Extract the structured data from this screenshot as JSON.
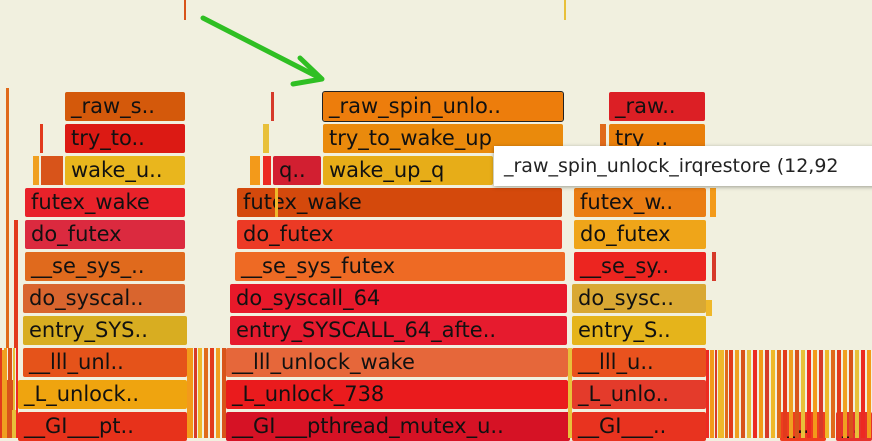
{
  "colors": {
    "background": "#f1f0df",
    "arrow": "#2fbf23",
    "selection_outline": "#222222"
  },
  "tooltip": {
    "text": "_raw_spin_unlock_irqrestore (12,92"
  },
  "frames": [
    {
      "id": "raw_s_left",
      "label": "_raw_s..",
      "color": "#d4590b"
    },
    {
      "id": "try_to_left",
      "label": "try_to..",
      "color": "#dc1a14"
    },
    {
      "id": "wake_u_left",
      "label": "wake_u..",
      "color": "#e9b61d"
    },
    {
      "id": "futex_wake_left",
      "label": "futex_wake",
      "color": "#e8222a"
    },
    {
      "id": "do_futex_left",
      "label": "do_futex",
      "color": "#db2a3f"
    },
    {
      "id": "se_sys_left",
      "label": "__se_sys_..",
      "color": "#e06a1d"
    },
    {
      "id": "do_syscall_left",
      "label": "do_syscal..",
      "color": "#d9652e"
    },
    {
      "id": "entry_sys_left",
      "label": "entry_SYS..",
      "color": "#d8ad21"
    },
    {
      "id": "lll_unl_left",
      "label": "__lll_unl..",
      "color": "#e5531a"
    },
    {
      "id": "l_unlock_left",
      "label": "_L_unlock..",
      "color": "#efa40f"
    },
    {
      "id": "gi_pt_left",
      "label": "__GI___pt..",
      "color": "#e7321b"
    },
    {
      "id": "raw_spin_unlo_mid",
      "label": "_raw_spin_unlo..",
      "color": "#ed7d0c",
      "selected": true
    },
    {
      "id": "try_to_wake_up_mid",
      "label": "try_to_wake_up",
      "color": "#ea8a0c"
    },
    {
      "id": "q_mid",
      "label": "q..",
      "color": "#d21f31"
    },
    {
      "id": "wake_up_q_mid",
      "label": "wake_up_q",
      "color": "#e7ad18"
    },
    {
      "id": "futex_wake_mid",
      "label": "futex_wake",
      "color": "#d4490c"
    },
    {
      "id": "do_futex_mid",
      "label": "do_futex",
      "color": "#ec3a25"
    },
    {
      "id": "se_sys_futex_mid",
      "label": "__se_sys_futex",
      "color": "#ee6a24"
    },
    {
      "id": "do_syscall_64_mid",
      "label": "do_syscall_64",
      "color": "#e8192a"
    },
    {
      "id": "entry_syscall_mid",
      "label": "entry_SYSCALL_64_afte..",
      "color": "#e61b2e"
    },
    {
      "id": "lll_unlock_wake_mid",
      "label": "__lll_unlock_wake",
      "color": "#e6673a"
    },
    {
      "id": "l_unlock_738_mid",
      "label": "_L_unlock_738",
      "color": "#ea1b1d"
    },
    {
      "id": "gi_pthread_mid",
      "label": "__GI___pthread_mutex_u..",
      "color": "#d61225"
    },
    {
      "id": "raw_right",
      "label": "_raw..",
      "color": "#dc1f25"
    },
    {
      "id": "try_right",
      "label": "try_..",
      "color": "#e97f0b"
    },
    {
      "id": "futex_w_right",
      "label": "futex_w..",
      "color": "#ea7d13"
    },
    {
      "id": "do_futex_right",
      "label": "do_futex",
      "color": "#efa519"
    },
    {
      "id": "se_sy_right",
      "label": "__se_sy..",
      "color": "#ec2520"
    },
    {
      "id": "do_sysc_right",
      "label": "do_sysc..",
      "color": "#d9a833"
    },
    {
      "id": "entry_s_right",
      "label": "entry_S..",
      "color": "#e5b41b"
    },
    {
      "id": "lll_u_right",
      "label": "__lll_u..",
      "color": "#e9521e"
    },
    {
      "id": "l_unlo_right",
      "label": "_L_unlo..",
      "color": "#e43b2b"
    },
    {
      "id": "gi_right",
      "label": "__GI___..",
      "color": "#e8331f"
    },
    {
      "id": "small_r1",
      "label": "_..",
      "color": "#ee3d1f"
    },
    {
      "id": "small_r2",
      "label": "_..",
      "color": "#e5322c"
    }
  ]
}
